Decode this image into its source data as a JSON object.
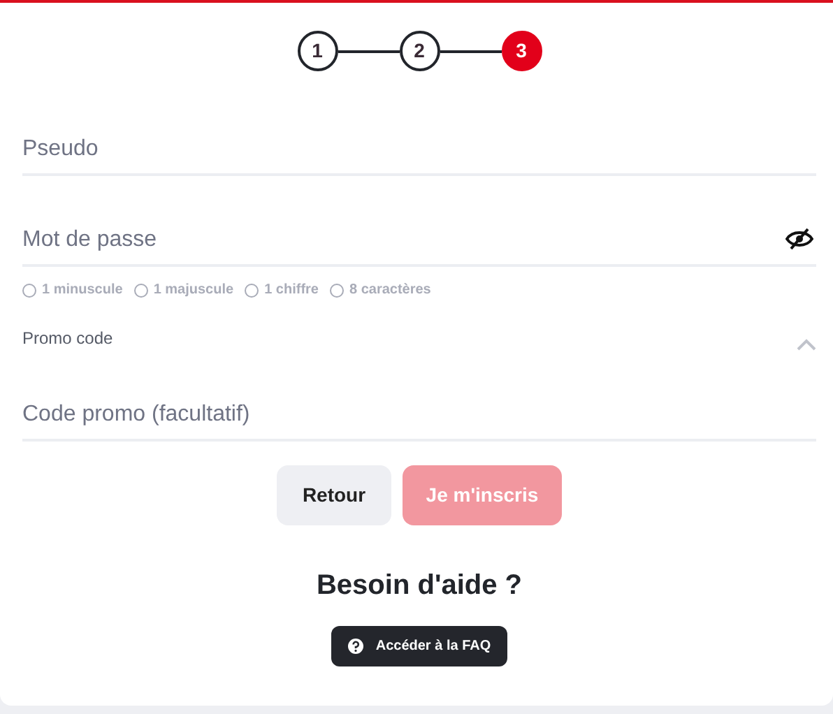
{
  "steps": [
    {
      "label": "1",
      "selected": false
    },
    {
      "label": "2",
      "selected": false
    },
    {
      "label": "3",
      "selected": true
    }
  ],
  "fields": [
    {
      "placeholder": "Pseudo",
      "kind": "text"
    },
    {
      "placeholder": "Mot de passe",
      "kind": "password"
    }
  ],
  "requirements": [
    {
      "label": "1 minuscule",
      "checked": false
    },
    {
      "label": "1 majuscule",
      "checked": false
    },
    {
      "label": "1 chiffre",
      "checked": false
    },
    {
      "label": "8 caractères",
      "checked": false
    }
  ],
  "promo": {
    "label": "Promo code",
    "expanded": true,
    "placeholder": "Code promo (facultatif)"
  },
  "buttons": [
    {
      "label": "Retour",
      "kind": "secondary",
      "disabled": false
    },
    {
      "label": "Je m'inscris",
      "kind": "primary",
      "disabled": true
    }
  ],
  "help": {
    "title": "Besoin d'aide ?",
    "link": "Accéder à la FAQ"
  }
}
